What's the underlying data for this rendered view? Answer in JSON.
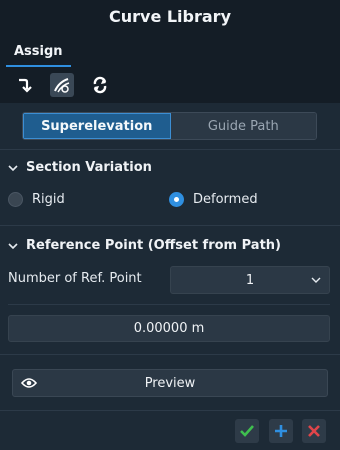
{
  "window": {
    "title": "Curve Library"
  },
  "tabs": [
    {
      "label": "Assign",
      "active": true
    }
  ],
  "toolbar": {
    "icons": [
      "curve-arrow-icon",
      "path-edit-icon",
      "refresh-cycle-icon"
    ],
    "active_index": 1
  },
  "mode": {
    "options": [
      "Superelevation",
      "Guide Path"
    ],
    "selected": "Superelevation"
  },
  "section_variation": {
    "title": "Section Variation",
    "options": [
      "Rigid",
      "Deformed"
    ],
    "selected": "Deformed"
  },
  "reference_point": {
    "title": "Reference Point (Offset from Path)",
    "count_label": "Number of Ref. Point",
    "count_value": "1",
    "offset_value": "0.00000 m"
  },
  "preview": {
    "label": "Preview"
  },
  "actions": [
    "confirm-icon",
    "add-icon",
    "close-icon"
  ],
  "colors": {
    "accent": "#2f8fe0",
    "title_bg": "#141d26",
    "panel_bg": "#1d2a36",
    "confirm": "#3fbf4f",
    "add": "#2f8fe0",
    "close": "#e0454a"
  }
}
